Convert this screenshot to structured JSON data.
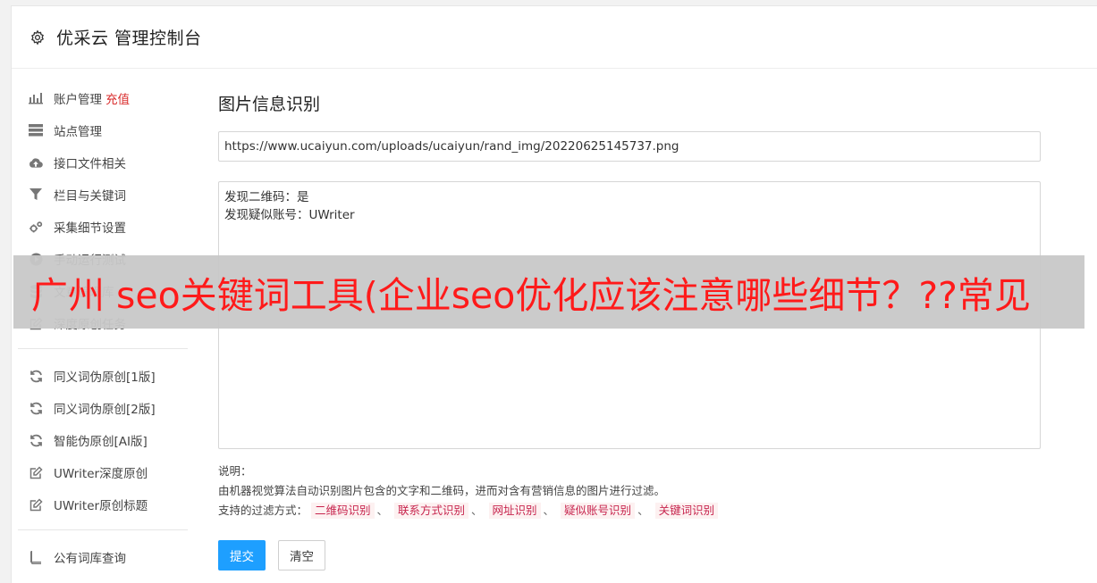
{
  "header": {
    "title": "优采云 管理控制台",
    "icon": "gear-icon"
  },
  "sidebar": {
    "groups": [
      [
        {
          "label": "账户管理",
          "extra": "充值",
          "icon": "bar-chart-icon"
        },
        {
          "label": "站点管理",
          "icon": "server-icon"
        },
        {
          "label": "接口文件相关",
          "icon": "cloud-upload-icon"
        },
        {
          "label": "栏目与关键词",
          "icon": "filter-icon"
        },
        {
          "label": "采集细节设置",
          "icon": "gears-icon"
        },
        {
          "label": "手动运行测试",
          "icon": "play-circle-icon"
        },
        {
          "label": "文章管理库",
          "icon": "database-icon"
        },
        {
          "label": "深度原创任务",
          "icon": "edit-icon"
        }
      ],
      [
        {
          "label": "同义词伪原创[1版]",
          "icon": "refresh-icon"
        },
        {
          "label": "同义词伪原创[2版]",
          "icon": "refresh-icon"
        },
        {
          "label": "智能伪原创[AI版]",
          "icon": "refresh-icon"
        },
        {
          "label": "UWriter深度原创",
          "icon": "edit-icon"
        },
        {
          "label": "UWriter原创标题",
          "icon": "edit-icon"
        }
      ],
      [
        {
          "label": "公有词库查询",
          "icon": "book-icon"
        }
      ]
    ]
  },
  "main": {
    "section_title": "图片信息识别",
    "url_value": "https://www.ucaiyun.com/uploads/ucaiyun/rand_img/20220625145737.png",
    "result_lines": [
      "发现二维码：是",
      "发现疑似账号：UWriter"
    ],
    "note_label": "说明：",
    "note_desc": "由机器视觉算法自动识别图片包含的文字和二维码，进而对含有营销信息的图片进行过滤。",
    "filter_label": "支持的过滤方式：",
    "filter_tags": [
      "二维码识别",
      "联系方式识别",
      "网址识别",
      "疑似账号识别",
      "关键词识别"
    ],
    "tag_separator": "、",
    "submit_label": "提交",
    "clear_label": "清空"
  },
  "overlay": {
    "text": "广州 seo关键词工具(企业seo优化应该注意哪些细节？??常见"
  },
  "colors": {
    "accent": "#1e9fff",
    "danger": "#d92c2c",
    "tag_text": "#c7254e",
    "overlay_text": "#ff1a1a"
  }
}
